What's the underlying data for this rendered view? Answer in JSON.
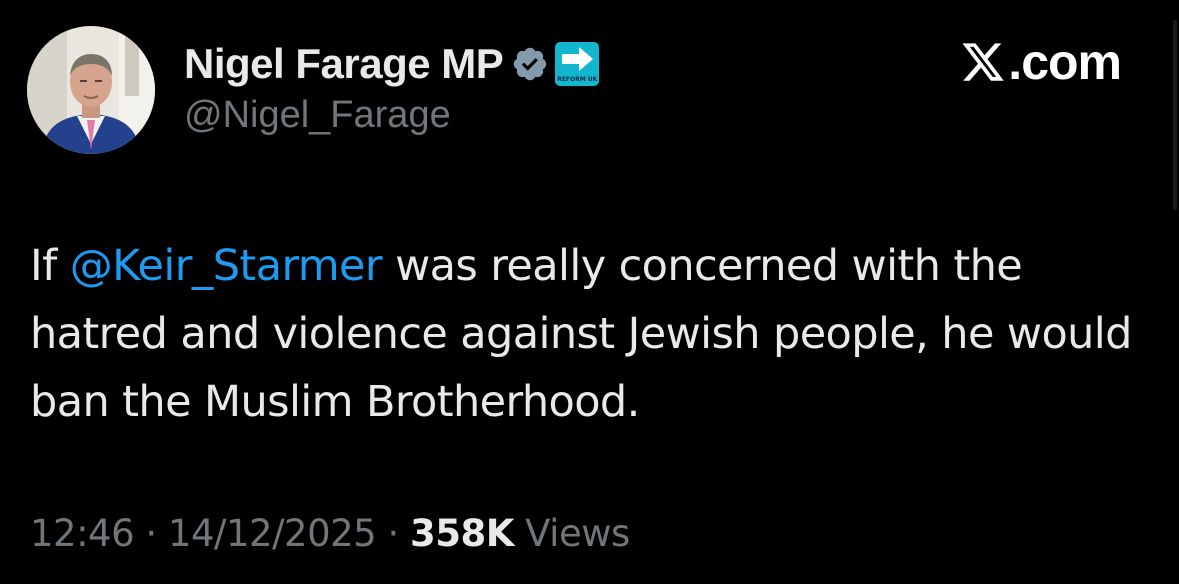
{
  "brand": {
    "logo_icon": "x-logo-icon",
    "text": ".com"
  },
  "author": {
    "avatar_icon": "avatar",
    "display_name": "Nigel Farage MP",
    "verified_icon": "verified-badge-icon",
    "affiliate_label": "REFORM UK",
    "handle": "@Nigel_Farage"
  },
  "tweet": {
    "text_before": "If ",
    "mention": "@Keir_Starmer",
    "text_after": " was really concerned with the hatred and violence against Jewish people, he would ban the Muslim Brotherhood."
  },
  "meta": {
    "time": "12:46",
    "separator1": " · ",
    "date": "14/12/2025",
    "separator2": " · ",
    "views_count": "358K",
    "views_label": " Views"
  },
  "colors": {
    "background": "#000000",
    "text": "#e7e9ea",
    "secondary_text": "#71767b",
    "mention": "#1d9bf0",
    "affiliate_badge": "#12b6cf"
  }
}
